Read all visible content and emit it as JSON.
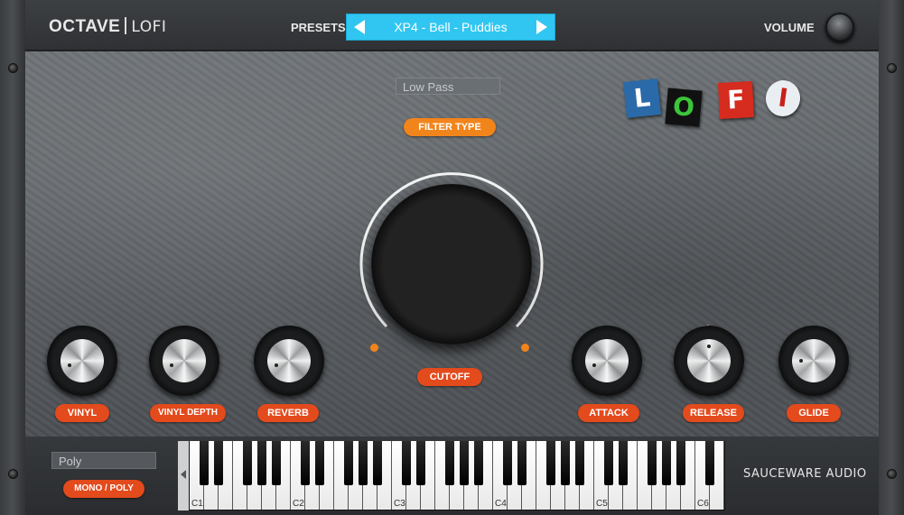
{
  "header": {
    "brand_main": "OCTAVE",
    "brand_sub": "LOFI",
    "presets_label": "PRESETS",
    "preset_name": "XP4 - Bell - Puddies",
    "volume_label": "VOLUME"
  },
  "panel": {
    "filter_type_value": "Low Pass",
    "filter_type_label": "FILTER TYPE",
    "logo_letters": [
      "L",
      "O",
      "F",
      "I"
    ],
    "cutoff_label": "CUTOFF",
    "knobs": [
      {
        "label": "VINYL"
      },
      {
        "label": "VINYL DEPTH"
      },
      {
        "label": "REVERB"
      },
      {
        "label": "ATTACK"
      },
      {
        "label": "RELEASE"
      },
      {
        "label": "GLIDE"
      }
    ]
  },
  "footer": {
    "voice_mode_value": "Poly",
    "voice_mode_label": "MONO / POLY",
    "octave_labels": [
      "C1",
      "C2",
      "C3",
      "C4",
      "C5",
      "C6"
    ],
    "company": "SAUCEWARE AUDIO"
  },
  "colors": {
    "accent_blue": "#31c6f2",
    "accent_orange": "#f2841c",
    "accent_red": "#e34a1c"
  }
}
